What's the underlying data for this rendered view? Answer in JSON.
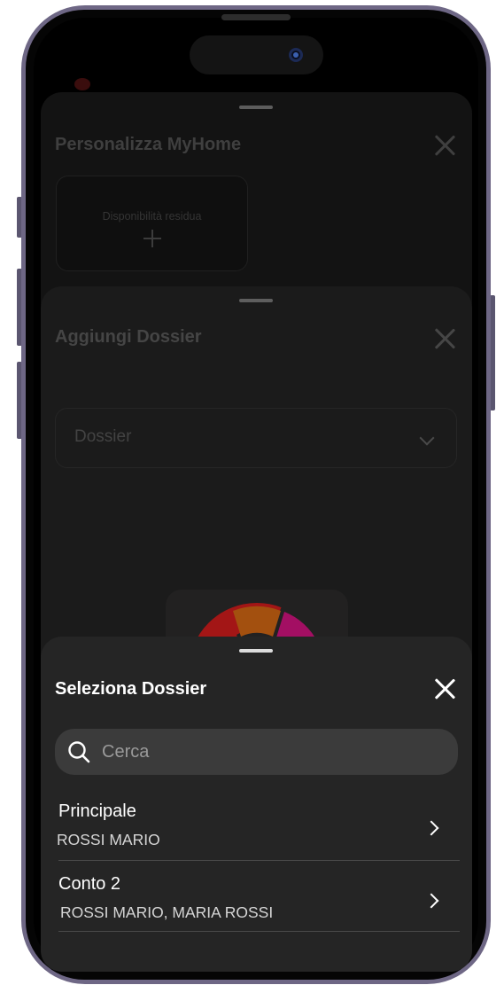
{
  "background_sheet": {
    "title": "Personalizza MyHome",
    "card_label": "Disponibilità residua"
  },
  "middle_sheet": {
    "title": "Aggiungi Dossier",
    "select_placeholder": "Dossier"
  },
  "active_sheet": {
    "title": "Seleziona Dossier",
    "search": {
      "placeholder": "Cerca",
      "value": ""
    },
    "items": [
      {
        "title": "Principale",
        "subtitle": "ROSSI MARIO"
      },
      {
        "title": "Conto 2",
        "subtitle": "ROSSI MARIO, MARIA ROSSI"
      }
    ]
  },
  "colors": {
    "active_sheet_bg": "#252525",
    "search_bg": "#3b3b3b",
    "donut_segments": [
      "#a31616",
      "#a3500f",
      "#a30f63"
    ]
  },
  "icons": [
    "close-icon",
    "plus-icon",
    "chevron-down-icon",
    "search-icon",
    "chevron-right-icon"
  ]
}
